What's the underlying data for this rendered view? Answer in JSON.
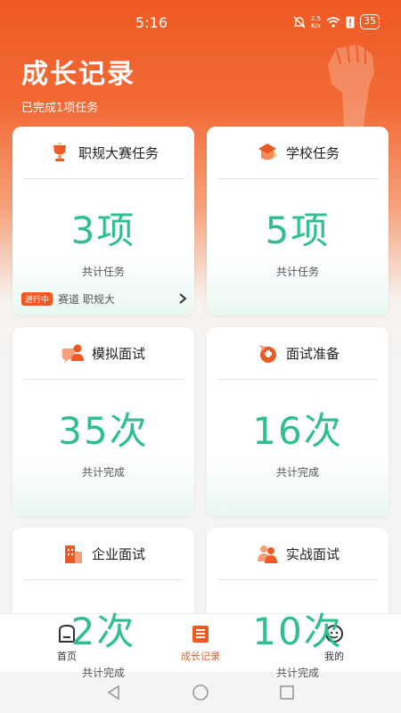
{
  "status_bar": {
    "time": "5:16",
    "net_speed_top": "2.5",
    "net_speed_bottom": "K/s",
    "battery": "35"
  },
  "header": {
    "title": "成长记录",
    "subtitle": "已完成1项任务"
  },
  "cards": [
    {
      "title": "职规大赛任务",
      "value": "3项",
      "label": "共计任务",
      "icon": "trophy-icon"
    },
    {
      "title": "学校任务",
      "value": "5项",
      "label": "共计任务",
      "icon": "school-icon"
    },
    {
      "title": "模拟面试",
      "value": "35次",
      "label": "共计完成",
      "icon": "mock-interview-icon"
    },
    {
      "title": "面试准备",
      "value": "16次",
      "label": "共计完成",
      "icon": "interview-prep-icon"
    },
    {
      "title": "企业面试",
      "value": "2次",
      "label": "共计完成",
      "icon": "company-icon"
    },
    {
      "title": "实战面试",
      "value": "10次",
      "label": "共计完成",
      "icon": "practice-interview-icon"
    }
  ],
  "ticker": {
    "tag": "进行中",
    "text": "赛道       职规大"
  },
  "bottom_nav": [
    {
      "label": "首页",
      "icon": "home-icon",
      "active": false
    },
    {
      "label": "成长记录",
      "icon": "growth-record-icon",
      "active": true
    },
    {
      "label": "我的",
      "icon": "profile-icon",
      "active": false
    }
  ],
  "colors": {
    "accent": "#ef5a24",
    "value_green": "#2fbf8e"
  }
}
